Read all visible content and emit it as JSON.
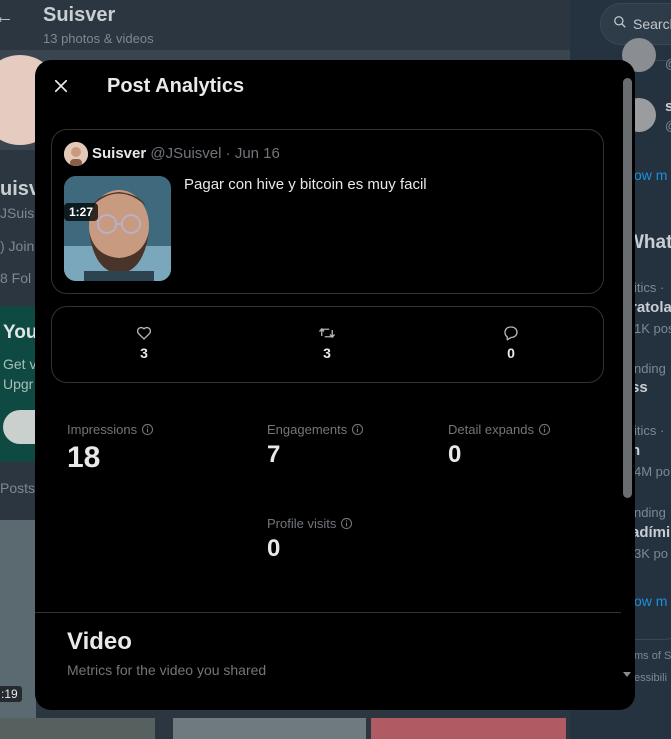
{
  "background": {
    "profile_title": "Suisver",
    "profile_subtitle": "13 photos & videos",
    "name_fragment": "uisv",
    "handle_fragment": "JSuis",
    "join_fragment": ") Join",
    "followers_fragment": "8 Fol",
    "promo_heading": "You",
    "promo_line1": "Get v",
    "promo_line2": "Upgr",
    "posts_tab_fragment": "Posts",
    "grid_duration_fragment": ":19",
    "search_placeholder": "Search",
    "right_rail": {
      "who_handle_1": "@",
      "who_name_2": "s",
      "who_handle_2": "@",
      "show_more_1": "ow m",
      "whats_heading": "What",
      "trend1_context": "itics ·",
      "trend1_title": "ratola",
      "trend1_count": "1K pos",
      "trend2_context": "nding",
      "trend2_title": "ss",
      "trend3_context": "itics ·",
      "trend3_title": "n",
      "trend3_count": "4M po",
      "trend4_context": "nding",
      "trend4_title": "adími",
      "trend4_count": "3K po",
      "show_more_2": "ow m",
      "footer1": "ms of Se",
      "footer2": "essibili"
    }
  },
  "modal": {
    "title": "Post Analytics",
    "post": {
      "author_name": "Suisver",
      "author_handle": "@JSuisvel",
      "separator": "·",
      "date": "Jun 16",
      "text": "Pagar con hive y bitcoin es muy facil",
      "video_duration": "1:27"
    },
    "engagement": {
      "likes": "3",
      "reposts": "3",
      "replies": "0"
    },
    "metrics": {
      "impressions_label": "Impressions",
      "impressions_value": "18",
      "engagements_label": "Engagements",
      "engagements_value": "7",
      "detail_expands_label": "Detail expands",
      "detail_expands_value": "0",
      "profile_visits_label": "Profile visits",
      "profile_visits_value": "0"
    },
    "video_section": {
      "title": "Video",
      "subtitle": "Metrics for the video you shared"
    }
  },
  "colors": {
    "modal_bg": "#000000",
    "border": "#2f3336",
    "muted_text": "#71767b",
    "primary_text": "#e7e9ea",
    "link_blue": "#1d9bf0"
  },
  "icons": {
    "close": "close-icon",
    "like": "heart-icon",
    "repost": "repost-icon",
    "reply": "reply-icon",
    "info": "info-icon",
    "search": "search-icon"
  }
}
